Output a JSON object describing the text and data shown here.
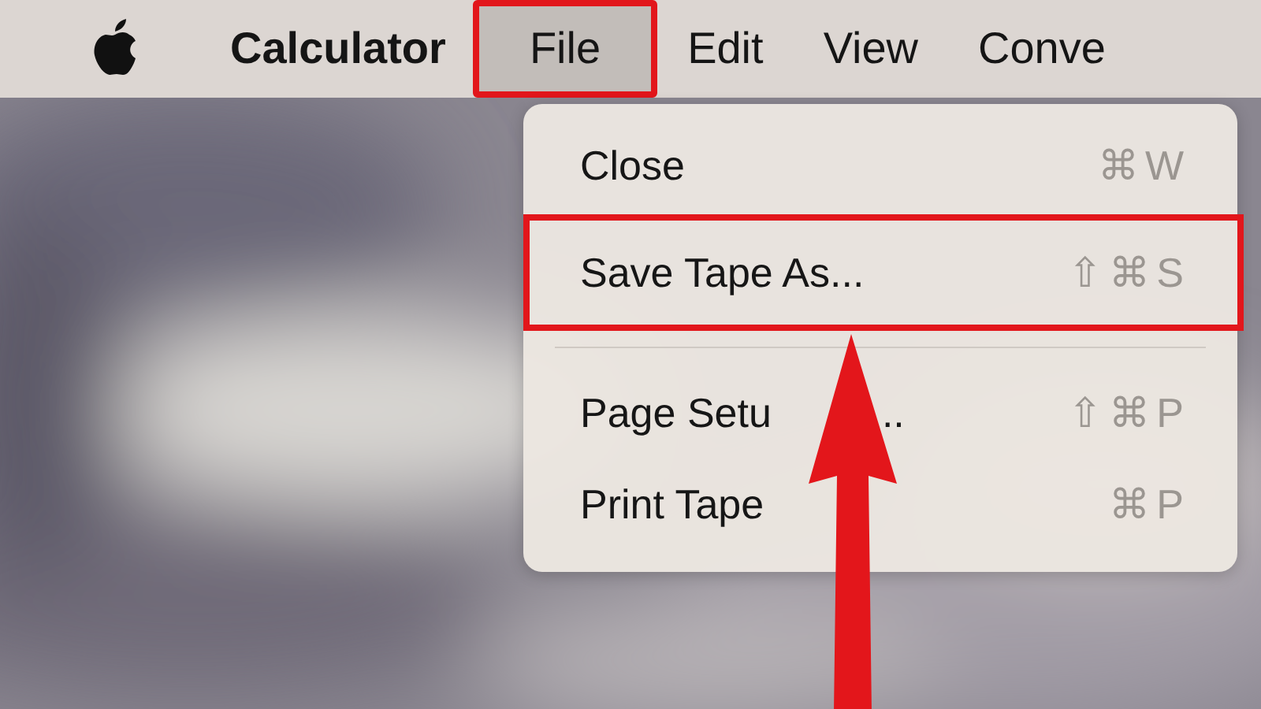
{
  "menu_bar": {
    "items": [
      {
        "label": "Calculator",
        "kind": "app",
        "selected": false,
        "annotated": false
      },
      {
        "label": "File",
        "kind": "menu",
        "selected": true,
        "annotated": true
      },
      {
        "label": "Edit",
        "kind": "menu",
        "selected": false,
        "annotated": false
      },
      {
        "label": "View",
        "kind": "menu",
        "selected": false,
        "annotated": false
      },
      {
        "label": "Conve",
        "kind": "menu",
        "selected": false,
        "annotated": false
      }
    ]
  },
  "file_menu": {
    "items": [
      {
        "kind": "item",
        "label": "Close",
        "shortcut": "⌘W",
        "annotated": false
      },
      {
        "kind": "item",
        "label": "Save Tape As...",
        "shortcut": "⇧⌘S",
        "annotated": true
      },
      {
        "kind": "separator"
      },
      {
        "kind": "item",
        "label": "Page Setu",
        "label_tail": "..",
        "shortcut": "⇧⌘P",
        "annotated": false
      },
      {
        "kind": "item",
        "label": "Print Tape",
        "shortcut": "⌘P",
        "annotated": false
      }
    ]
  }
}
